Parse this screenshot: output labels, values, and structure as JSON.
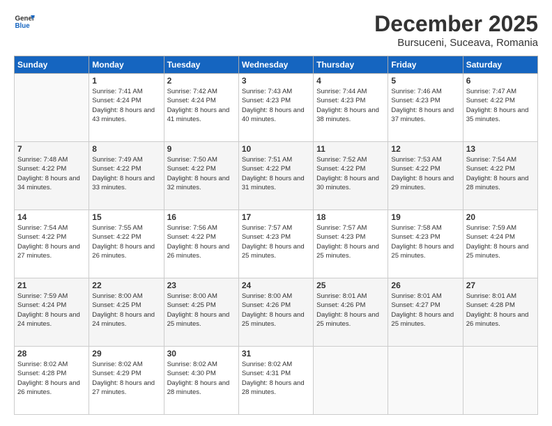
{
  "header": {
    "logo_line1": "General",
    "logo_line2": "Blue",
    "month": "December 2025",
    "location": "Bursuceni, Suceava, Romania"
  },
  "days_of_week": [
    "Sunday",
    "Monday",
    "Tuesday",
    "Wednesday",
    "Thursday",
    "Friday",
    "Saturday"
  ],
  "weeks": [
    [
      {
        "day": "",
        "sunrise": "",
        "sunset": "",
        "daylight": ""
      },
      {
        "day": "1",
        "sunrise": "Sunrise: 7:41 AM",
        "sunset": "Sunset: 4:24 PM",
        "daylight": "Daylight: 8 hours and 43 minutes."
      },
      {
        "day": "2",
        "sunrise": "Sunrise: 7:42 AM",
        "sunset": "Sunset: 4:24 PM",
        "daylight": "Daylight: 8 hours and 41 minutes."
      },
      {
        "day": "3",
        "sunrise": "Sunrise: 7:43 AM",
        "sunset": "Sunset: 4:23 PM",
        "daylight": "Daylight: 8 hours and 40 minutes."
      },
      {
        "day": "4",
        "sunrise": "Sunrise: 7:44 AM",
        "sunset": "Sunset: 4:23 PM",
        "daylight": "Daylight: 8 hours and 38 minutes."
      },
      {
        "day": "5",
        "sunrise": "Sunrise: 7:46 AM",
        "sunset": "Sunset: 4:23 PM",
        "daylight": "Daylight: 8 hours and 37 minutes."
      },
      {
        "day": "6",
        "sunrise": "Sunrise: 7:47 AM",
        "sunset": "Sunset: 4:22 PM",
        "daylight": "Daylight: 8 hours and 35 minutes."
      }
    ],
    [
      {
        "day": "7",
        "sunrise": "Sunrise: 7:48 AM",
        "sunset": "Sunset: 4:22 PM",
        "daylight": "Daylight: 8 hours and 34 minutes."
      },
      {
        "day": "8",
        "sunrise": "Sunrise: 7:49 AM",
        "sunset": "Sunset: 4:22 PM",
        "daylight": "Daylight: 8 hours and 33 minutes."
      },
      {
        "day": "9",
        "sunrise": "Sunrise: 7:50 AM",
        "sunset": "Sunset: 4:22 PM",
        "daylight": "Daylight: 8 hours and 32 minutes."
      },
      {
        "day": "10",
        "sunrise": "Sunrise: 7:51 AM",
        "sunset": "Sunset: 4:22 PM",
        "daylight": "Daylight: 8 hours and 31 minutes."
      },
      {
        "day": "11",
        "sunrise": "Sunrise: 7:52 AM",
        "sunset": "Sunset: 4:22 PM",
        "daylight": "Daylight: 8 hours and 30 minutes."
      },
      {
        "day": "12",
        "sunrise": "Sunrise: 7:53 AM",
        "sunset": "Sunset: 4:22 PM",
        "daylight": "Daylight: 8 hours and 29 minutes."
      },
      {
        "day": "13",
        "sunrise": "Sunrise: 7:54 AM",
        "sunset": "Sunset: 4:22 PM",
        "daylight": "Daylight: 8 hours and 28 minutes."
      }
    ],
    [
      {
        "day": "14",
        "sunrise": "Sunrise: 7:54 AM",
        "sunset": "Sunset: 4:22 PM",
        "daylight": "Daylight: 8 hours and 27 minutes."
      },
      {
        "day": "15",
        "sunrise": "Sunrise: 7:55 AM",
        "sunset": "Sunset: 4:22 PM",
        "daylight": "Daylight: 8 hours and 26 minutes."
      },
      {
        "day": "16",
        "sunrise": "Sunrise: 7:56 AM",
        "sunset": "Sunset: 4:22 PM",
        "daylight": "Daylight: 8 hours and 26 minutes."
      },
      {
        "day": "17",
        "sunrise": "Sunrise: 7:57 AM",
        "sunset": "Sunset: 4:23 PM",
        "daylight": "Daylight: 8 hours and 25 minutes."
      },
      {
        "day": "18",
        "sunrise": "Sunrise: 7:57 AM",
        "sunset": "Sunset: 4:23 PM",
        "daylight": "Daylight: 8 hours and 25 minutes."
      },
      {
        "day": "19",
        "sunrise": "Sunrise: 7:58 AM",
        "sunset": "Sunset: 4:23 PM",
        "daylight": "Daylight: 8 hours and 25 minutes."
      },
      {
        "day": "20",
        "sunrise": "Sunrise: 7:59 AM",
        "sunset": "Sunset: 4:24 PM",
        "daylight": "Daylight: 8 hours and 25 minutes."
      }
    ],
    [
      {
        "day": "21",
        "sunrise": "Sunrise: 7:59 AM",
        "sunset": "Sunset: 4:24 PM",
        "daylight": "Daylight: 8 hours and 24 minutes."
      },
      {
        "day": "22",
        "sunrise": "Sunrise: 8:00 AM",
        "sunset": "Sunset: 4:25 PM",
        "daylight": "Daylight: 8 hours and 24 minutes."
      },
      {
        "day": "23",
        "sunrise": "Sunrise: 8:00 AM",
        "sunset": "Sunset: 4:25 PM",
        "daylight": "Daylight: 8 hours and 25 minutes."
      },
      {
        "day": "24",
        "sunrise": "Sunrise: 8:00 AM",
        "sunset": "Sunset: 4:26 PM",
        "daylight": "Daylight: 8 hours and 25 minutes."
      },
      {
        "day": "25",
        "sunrise": "Sunrise: 8:01 AM",
        "sunset": "Sunset: 4:26 PM",
        "daylight": "Daylight: 8 hours and 25 minutes."
      },
      {
        "day": "26",
        "sunrise": "Sunrise: 8:01 AM",
        "sunset": "Sunset: 4:27 PM",
        "daylight": "Daylight: 8 hours and 25 minutes."
      },
      {
        "day": "27",
        "sunrise": "Sunrise: 8:01 AM",
        "sunset": "Sunset: 4:28 PM",
        "daylight": "Daylight: 8 hours and 26 minutes."
      }
    ],
    [
      {
        "day": "28",
        "sunrise": "Sunrise: 8:02 AM",
        "sunset": "Sunset: 4:28 PM",
        "daylight": "Daylight: 8 hours and 26 minutes."
      },
      {
        "day": "29",
        "sunrise": "Sunrise: 8:02 AM",
        "sunset": "Sunset: 4:29 PM",
        "daylight": "Daylight: 8 hours and 27 minutes."
      },
      {
        "day": "30",
        "sunrise": "Sunrise: 8:02 AM",
        "sunset": "Sunset: 4:30 PM",
        "daylight": "Daylight: 8 hours and 28 minutes."
      },
      {
        "day": "31",
        "sunrise": "Sunrise: 8:02 AM",
        "sunset": "Sunset: 4:31 PM",
        "daylight": "Daylight: 8 hours and 28 minutes."
      },
      {
        "day": "",
        "sunrise": "",
        "sunset": "",
        "daylight": ""
      },
      {
        "day": "",
        "sunrise": "",
        "sunset": "",
        "daylight": ""
      },
      {
        "day": "",
        "sunrise": "",
        "sunset": "",
        "daylight": ""
      }
    ]
  ]
}
